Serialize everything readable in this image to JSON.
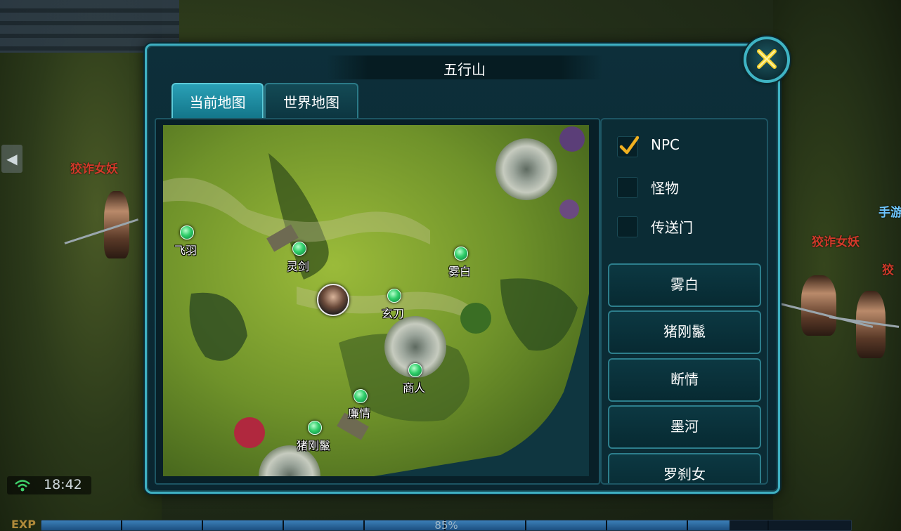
{
  "window": {
    "title": "五行山"
  },
  "tabs": [
    {
      "label": "当前地图",
      "active": true
    },
    {
      "label": "世界地图",
      "active": false
    }
  ],
  "filters": [
    {
      "label": "NPC",
      "checked": true
    },
    {
      "label": "怪物",
      "checked": false
    },
    {
      "label": "传送门",
      "checked": false
    }
  ],
  "npc_list": [
    "雾白",
    "猪刚鬣",
    "断情",
    "墨河",
    "罗刹女"
  ],
  "map_markers": [
    "飞羽",
    "灵剑",
    "雾白",
    "玄刀",
    "商人",
    "廉情",
    "猪刚鬣"
  ],
  "scene": {
    "enemy_name": "狡诈女妖",
    "enemy_name_partial": "狡",
    "other_player_partial": "手游"
  },
  "status": {
    "time": "18:42",
    "exp_label": "EXP",
    "exp_percent_text": "85%",
    "exp_fraction": 0.85
  },
  "colors": {
    "panel_border": "#3fb0c2",
    "npc_marker": "#2fce6a",
    "enemy_name": "#d23a2a"
  },
  "icons": {
    "close": "crossed-swords-icon",
    "check": "checkmark-icon",
    "wifi": "wifi-icon"
  }
}
